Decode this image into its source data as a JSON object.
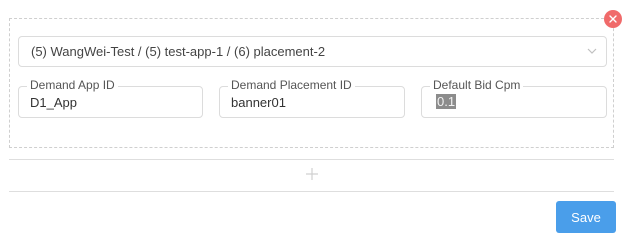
{
  "selector": {
    "value": "(5) WangWei-Test / (5) test-app-1 / (6) placement-2"
  },
  "fields": [
    {
      "label": "Demand App ID",
      "value": "D1_App"
    },
    {
      "label": "Demand Placement ID",
      "value": "banner01"
    },
    {
      "label": "Default Bid Cpm",
      "value": "0.1"
    }
  ],
  "actions": {
    "save_label": "Save"
  },
  "colors": {
    "remove": "#f06a6a",
    "primary": "#4a9eea"
  }
}
